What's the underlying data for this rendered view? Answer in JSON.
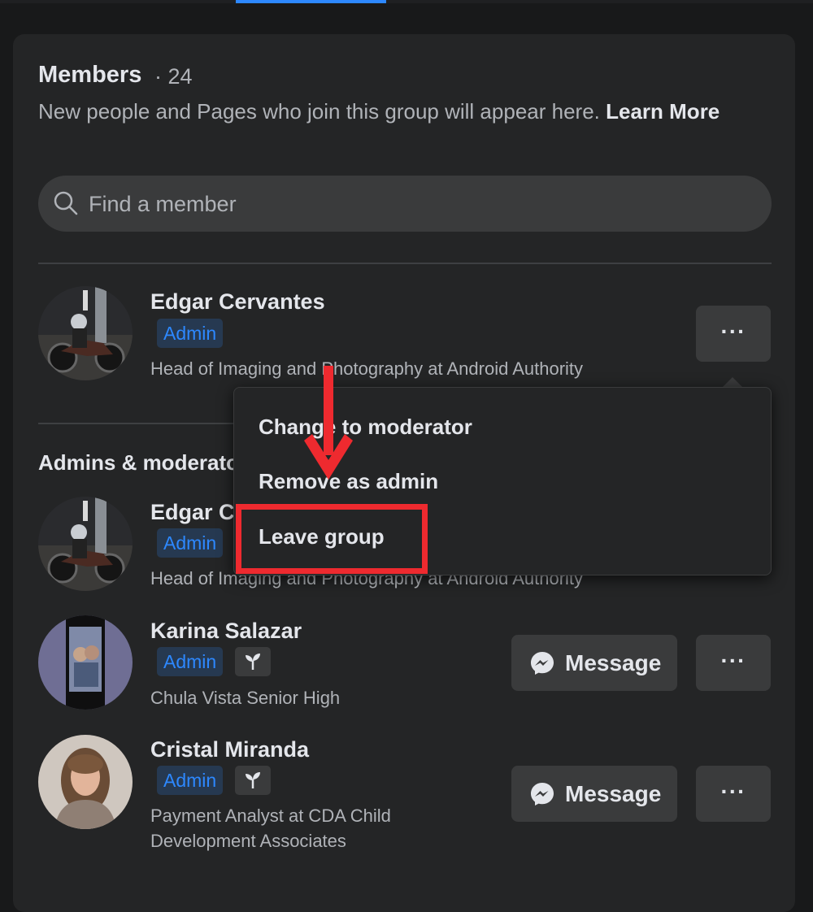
{
  "header": {
    "title": "Members",
    "count": "· 24",
    "description": "New people and Pages who join this group will appear here.",
    "learn_more": "Learn More"
  },
  "search": {
    "placeholder": "Find a member",
    "icon": "search-icon"
  },
  "featured_member": {
    "name": "Edgar Cervantes",
    "badge": "Admin",
    "subtitle": "Head of Imaging and Photography at Android Authority",
    "more_label": "···"
  },
  "menu": {
    "items": [
      {
        "label": "Change to moderator"
      },
      {
        "label": "Remove as admin"
      },
      {
        "label": "Leave group"
      }
    ]
  },
  "section": {
    "title": "Admins & moderators"
  },
  "admins": [
    {
      "name": "Edgar Cervantes",
      "badge": "Admin",
      "subtitle": "Head of Imaging and Photography at Android Authority"
    },
    {
      "name": "Karina Salazar",
      "badge": "Admin",
      "subtitle": "Chula Vista Senior High",
      "message_label": "Message",
      "more_label": "···"
    },
    {
      "name": "Cristal Miranda",
      "badge": "Admin",
      "subtitle": "Payment Analyst at CDA Child Development Associates",
      "message_label": "Message",
      "more_label": "···"
    }
  ],
  "colors": {
    "background": "#18191a",
    "card": "#242526",
    "accent": "#2d88ff",
    "annotation": "#ee2a2f"
  }
}
